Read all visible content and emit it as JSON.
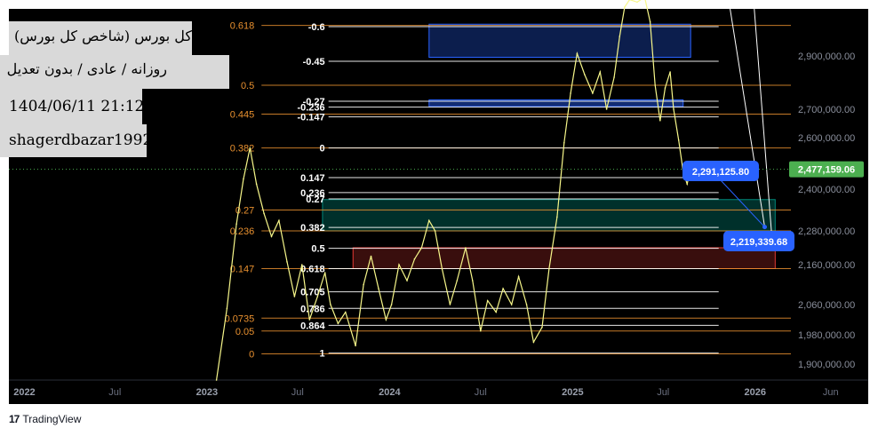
{
  "colors": {
    "background": "#000000",
    "fib_left": "#e8902f",
    "fib_right_line": "#ffffff",
    "price_line": "#f7f78a",
    "green_box": "#00897b",
    "red_box": "#e53935",
    "blue_box": "#2962ff",
    "callout": "#2962ff",
    "last_price": "#4caf50"
  },
  "info_boxes": [
    {
      "text": "کل بورس (شاخص کل بورس)"
    },
    {
      "text": "روزانه / عادی / بدون تعدیل"
    },
    {
      "text": "1404/06/11 21:12"
    },
    {
      "text": "shagerdbazar1992"
    }
  ],
  "footer": {
    "brand": "TradingView"
  },
  "chart_data": {
    "type": "line",
    "title": "کل بورس (شاخص کل بورس)",
    "subtitle": "روزانه / عادی / بدون تعدیل",
    "xlabel": "",
    "ylabel": "",
    "x_tick_labels": [
      "2022",
      "Jul",
      "2023",
      "Jul",
      "2024",
      "Jul",
      "2025",
      "Jul",
      "2026",
      "Jun"
    ],
    "y_tick_labels": [
      "2,900,000.00",
      "2,700,000.00",
      "2,600,000.00",
      "2,400,000.00",
      "2,280,000.00",
      "2,160,000.00",
      "2,060,000.00",
      "1,980,000.00",
      "1,900,000.00"
    ],
    "ylim": [
      1880000,
      3100000
    ],
    "grid": false,
    "last_price": {
      "value": 2477159.06,
      "label": "2,477,159.06"
    },
    "callouts": [
      {
        "label": "2,291,125.80",
        "value": 2291125.8
      },
      {
        "label": "2,219,339.68",
        "value": 2219339.68
      }
    ],
    "fib_left": [
      {
        "label": "0.618",
        "value": 3025000
      },
      {
        "label": "0.5",
        "value": 2790000
      },
      {
        "label": "0.445",
        "value": 2683000
      },
      {
        "label": "0.382",
        "value": 2560000
      },
      {
        "label": "0.27",
        "value": 2340000
      },
      {
        "label": "0.236",
        "value": 2280000
      },
      {
        "label": "0.147",
        "value": 2150000
      },
      {
        "label": "0.0735",
        "value": 2024000
      },
      {
        "label": "0.05",
        "value": 1990000
      },
      {
        "label": "0",
        "value": 1928000
      }
    ],
    "fib_right": [
      {
        "label": "-0.6",
        "value": 3020000
      },
      {
        "label": "-0.45",
        "value": 2880000
      },
      {
        "label": "-0.27",
        "value": 2730000
      },
      {
        "label": "-0.236",
        "value": 2708000
      },
      {
        "label": "-0.147",
        "value": 2673000
      },
      {
        "label": "0",
        "value": 2560000
      },
      {
        "label": "0.147",
        "value": 2445000
      },
      {
        "label": "0.236",
        "value": 2390000
      },
      {
        "label": "0.27",
        "value": 2372000
      },
      {
        "label": "0.382",
        "value": 2290000
      },
      {
        "label": "0.5",
        "value": 2218000
      },
      {
        "label": "0.618",
        "value": 2150000
      },
      {
        "label": "0.705",
        "value": 2092000
      },
      {
        "label": "0.786",
        "value": 2050000
      },
      {
        "label": "0.864",
        "value": 2005000
      },
      {
        "label": "1",
        "value": 1930000
      }
    ],
    "zones": [
      {
        "name": "blue-top",
        "from": 2895000,
        "to": 3030000,
        "x_from": "2024-03-20",
        "x_to": "2025-08-25"
      },
      {
        "name": "blue-mid",
        "from": 2710000,
        "to": 2735000,
        "x_from": "2024-03-20",
        "x_to": "2025-08-10"
      },
      {
        "name": "green",
        "from": 2280000,
        "to": 2370000,
        "x_from": "2023-08-20",
        "x_to": "2026-02-10"
      },
      {
        "name": "red",
        "from": 2150000,
        "to": 2220000,
        "x_from": "2023-10-20",
        "x_to": "2026-02-10"
      }
    ],
    "series": [
      {
        "values": [
          {
            "x": "2023-01-20",
            "y": 1880000
          },
          {
            "x": "2023-02-10",
            "y": 2050000
          },
          {
            "x": "2023-03-01",
            "y": 2300000
          },
          {
            "x": "2023-03-15",
            "y": 2440000
          },
          {
            "x": "2023-03-28",
            "y": 2560000
          },
          {
            "x": "2023-04-10",
            "y": 2420000
          },
          {
            "x": "2023-04-25",
            "y": 2330000
          },
          {
            "x": "2023-05-10",
            "y": 2260000
          },
          {
            "x": "2023-05-25",
            "y": 2310000
          },
          {
            "x": "2023-06-10",
            "y": 2170000
          },
          {
            "x": "2023-06-25",
            "y": 2080000
          },
          {
            "x": "2023-07-10",
            "y": 2160000
          },
          {
            "x": "2023-07-25",
            "y": 2020000
          },
          {
            "x": "2023-08-10",
            "y": 2080000
          },
          {
            "x": "2023-08-25",
            "y": 2140000
          },
          {
            "x": "2023-09-05",
            "y": 2060000
          },
          {
            "x": "2023-09-20",
            "y": 2010000
          },
          {
            "x": "2023-10-05",
            "y": 2040000
          },
          {
            "x": "2023-10-25",
            "y": 1950000
          },
          {
            "x": "2023-11-10",
            "y": 2110000
          },
          {
            "x": "2023-11-25",
            "y": 2190000
          },
          {
            "x": "2023-12-10",
            "y": 2100000
          },
          {
            "x": "2023-12-25",
            "y": 2020000
          },
          {
            "x": "2024-01-05",
            "y": 2060000
          },
          {
            "x": "2024-01-20",
            "y": 2160000
          },
          {
            "x": "2024-02-05",
            "y": 2120000
          },
          {
            "x": "2024-02-20",
            "y": 2180000
          },
          {
            "x": "2024-03-05",
            "y": 2220000
          },
          {
            "x": "2024-03-20",
            "y": 2310000
          },
          {
            "x": "2024-04-01",
            "y": 2280000
          },
          {
            "x": "2024-04-15",
            "y": 2150000
          },
          {
            "x": "2024-05-01",
            "y": 2060000
          },
          {
            "x": "2024-05-15",
            "y": 2120000
          },
          {
            "x": "2024-06-01",
            "y": 2220000
          },
          {
            "x": "2024-06-15",
            "y": 2120000
          },
          {
            "x": "2024-07-01",
            "y": 1990000
          },
          {
            "x": "2024-07-15",
            "y": 2070000
          },
          {
            "x": "2024-08-01",
            "y": 2040000
          },
          {
            "x": "2024-08-15",
            "y": 2100000
          },
          {
            "x": "2024-09-01",
            "y": 2060000
          },
          {
            "x": "2024-09-15",
            "y": 2130000
          },
          {
            "x": "2024-10-01",
            "y": 2060000
          },
          {
            "x": "2024-10-15",
            "y": 1960000
          },
          {
            "x": "2024-11-01",
            "y": 2000000
          },
          {
            "x": "2024-11-15",
            "y": 2150000
          },
          {
            "x": "2024-12-01",
            "y": 2320000
          },
          {
            "x": "2024-12-15",
            "y": 2580000
          },
          {
            "x": "2024-12-28",
            "y": 2760000
          },
          {
            "x": "2025-01-10",
            "y": 2910000
          },
          {
            "x": "2025-01-25",
            "y": 2830000
          },
          {
            "x": "2025-02-10",
            "y": 2760000
          },
          {
            "x": "2025-02-25",
            "y": 2840000
          },
          {
            "x": "2025-03-10",
            "y": 2700000
          },
          {
            "x": "2025-03-25",
            "y": 2820000
          },
          {
            "x": "2025-04-05",
            "y": 2980000
          },
          {
            "x": "2025-04-15",
            "y": 3100000
          },
          {
            "x": "2025-04-25",
            "y": 3130000
          },
          {
            "x": "2025-05-10",
            "y": 3120000
          },
          {
            "x": "2025-05-25",
            "y": 3140000
          },
          {
            "x": "2025-06-05",
            "y": 3040000
          },
          {
            "x": "2025-06-15",
            "y": 2790000
          },
          {
            "x": "2025-06-25",
            "y": 2660000
          },
          {
            "x": "2025-07-05",
            "y": 2780000
          },
          {
            "x": "2025-07-15",
            "y": 2840000
          },
          {
            "x": "2025-07-22",
            "y": 2700000
          },
          {
            "x": "2025-08-01",
            "y": 2590000
          },
          {
            "x": "2025-08-10",
            "y": 2470000
          },
          {
            "x": "2025-08-18",
            "y": 2420000
          },
          {
            "x": "2025-08-25",
            "y": 2477159
          }
        ]
      }
    ]
  }
}
